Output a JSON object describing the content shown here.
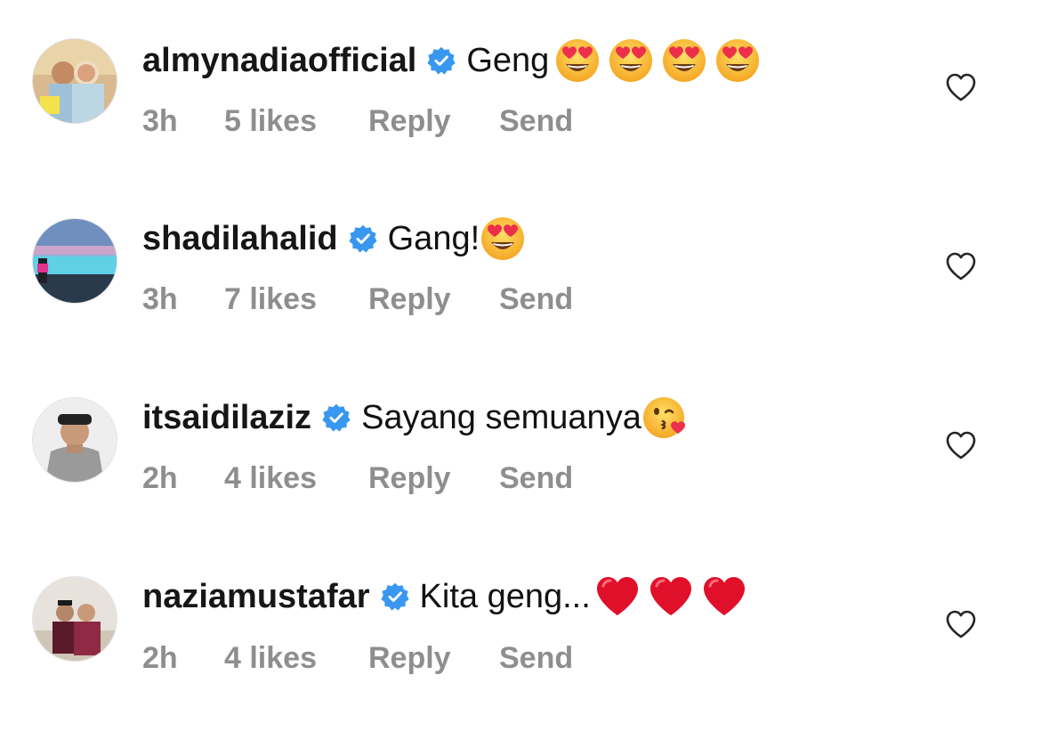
{
  "comments": [
    {
      "username": "almynadiaofficial",
      "text": "Geng ",
      "emoji": [
        "heart-eyes",
        "heart-eyes",
        "heart-eyes",
        "heart-eyes"
      ],
      "time": "3h",
      "likes": "5 likes",
      "reply": "Reply",
      "send": "Send"
    },
    {
      "username": "shadilahalid",
      "text": "Gang!",
      "emoji": [
        "heart-eyes"
      ],
      "time": "3h",
      "likes": "7 likes",
      "reply": "Reply",
      "send": "Send"
    },
    {
      "username": "itsaidilaziz",
      "text": "Sayang semuanya",
      "emoji": [
        "kissing-heart"
      ],
      "time": "2h",
      "likes": "4 likes",
      "reply": "Reply",
      "send": "Send"
    },
    {
      "username": "naziamustafar",
      "text": "Kita geng...",
      "emoji": [
        "red-heart",
        "red-heart",
        "red-heart"
      ],
      "time": "2h",
      "likes": "4 likes",
      "reply": "Reply",
      "send": "Send"
    }
  ],
  "colors": {
    "verified_blue": "#3897f0",
    "meta_gray": "#8e8e8e",
    "username": "#161616"
  },
  "icons": {
    "verified": "verified-badge-icon",
    "like": "heart-outline-icon"
  }
}
